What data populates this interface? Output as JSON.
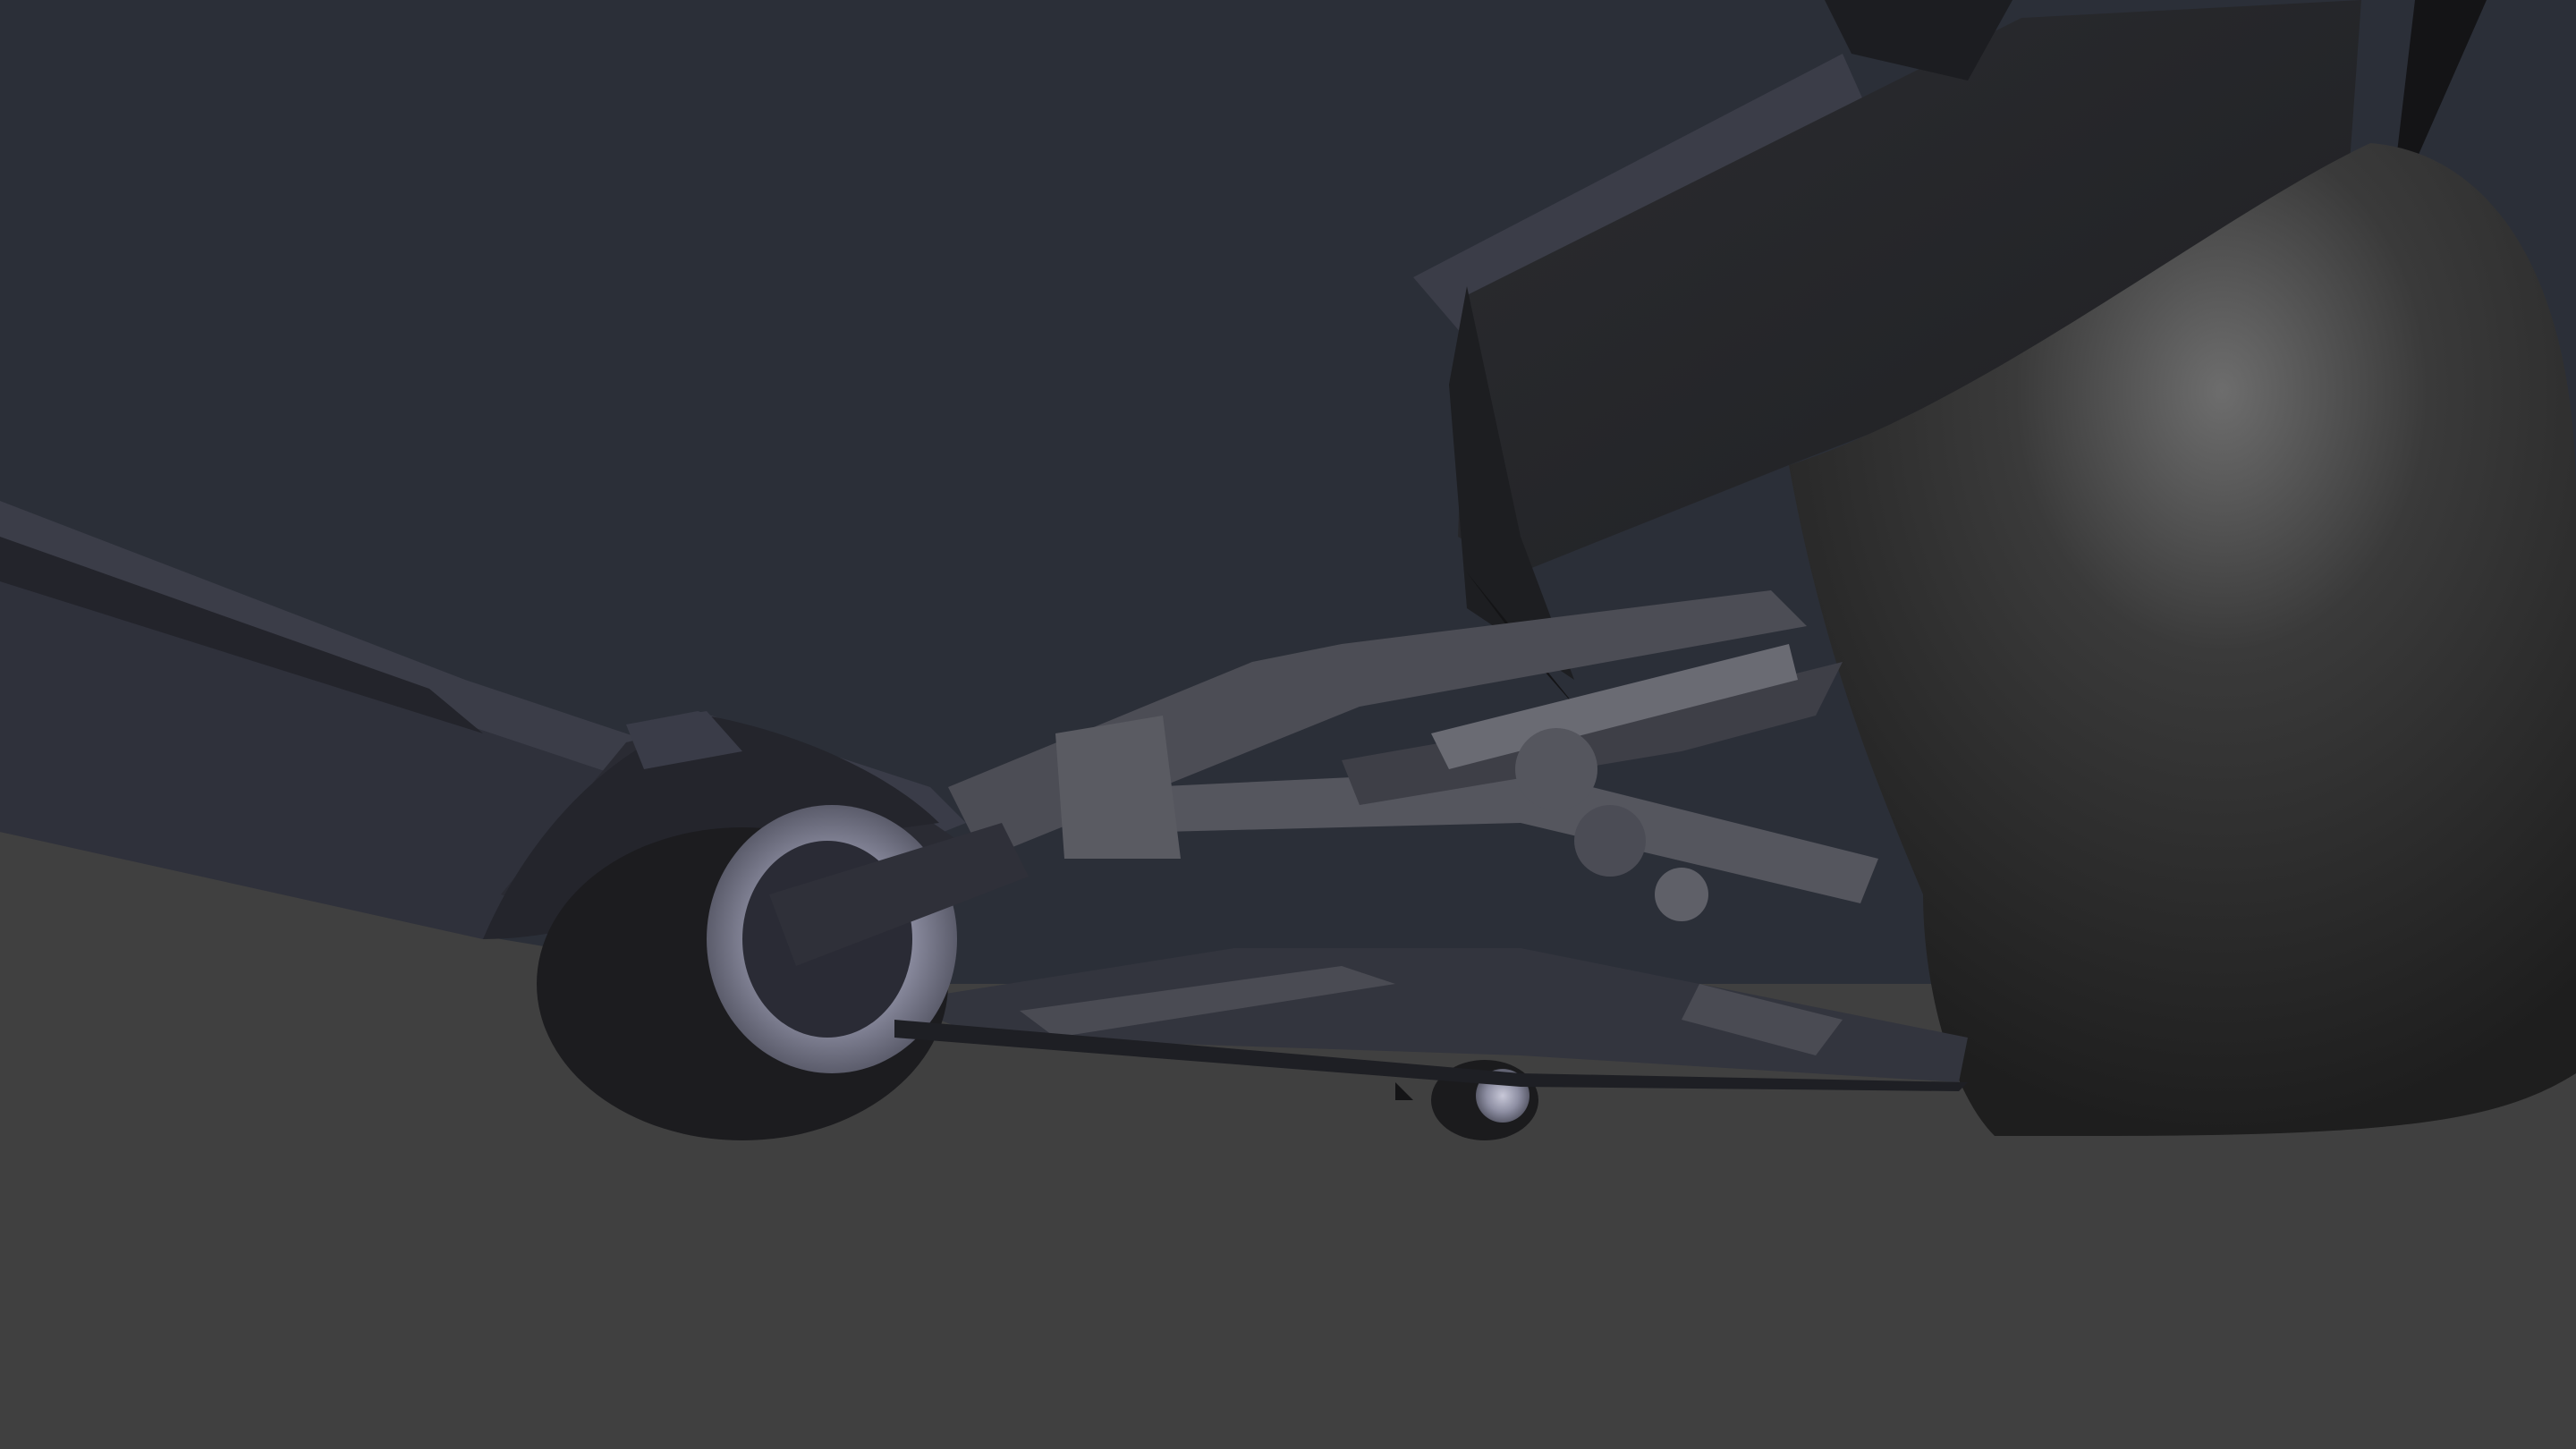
{
  "viewport": {
    "background_color": "#404040",
    "sky_color": "#2b2f38",
    "shading": "solid"
  },
  "scene": {
    "objects": [
      {
        "name": "car-body",
        "color": "#34363f"
      },
      {
        "name": "side-skirt",
        "color": "#2a2b33"
      },
      {
        "name": "front-fender",
        "color": "#24252c"
      },
      {
        "name": "front-wheel",
        "color": "#1c1c1f"
      },
      {
        "name": "rear-wheel",
        "color": "#1b1b1d"
      },
      {
        "name": "rear-wing",
        "color": "#242528"
      },
      {
        "name": "suspension-arms",
        "color": "#5a5b62"
      },
      {
        "name": "rear-tyre-cover",
        "color": "#2a2a2a"
      }
    ]
  }
}
